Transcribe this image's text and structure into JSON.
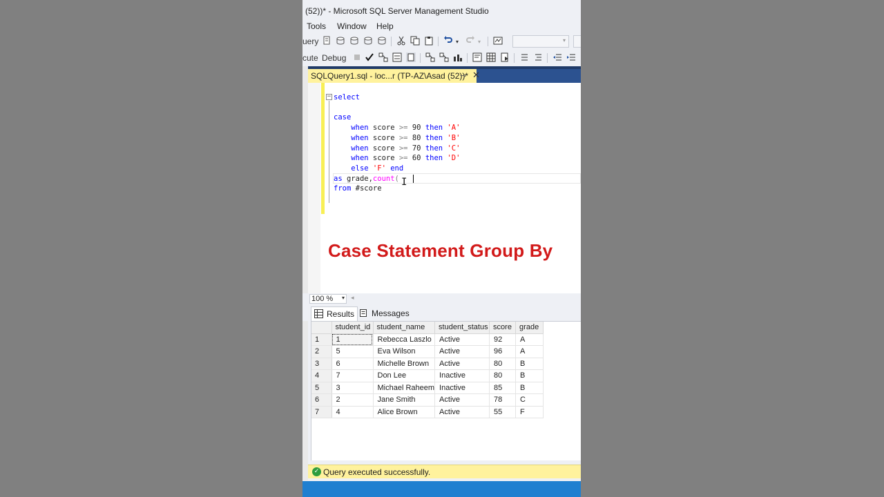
{
  "window": {
    "title": "(52))* - Microsoft SQL Server Management Studio"
  },
  "menu": [
    "Tools",
    "Window",
    "Help"
  ],
  "toolbar1": {
    "query_label": "uery"
  },
  "toolbar2": {
    "execute_label": "cute",
    "debug_label": "Debug"
  },
  "tab": {
    "label": "SQLQuery1.sql - loc...r (TP-AZ\\Asad (52))*",
    "pin": "⊸",
    "close": "✕"
  },
  "editor": {
    "line1": "select",
    "line_case": "case",
    "when": "when",
    "then": "then",
    "else": "else",
    "end": "end",
    "as": "as",
    "from": "from",
    "score": "score",
    "grade": " grade,",
    "count": "count",
    "table": " #score",
    "op_ge": ">=",
    "conditions": [
      {
        "value": "90",
        "grade": "'A'"
      },
      {
        "value": "80",
        "grade": "'B'"
      },
      {
        "value": "70",
        "grade": "'C'"
      },
      {
        "value": "60",
        "grade": "'D'"
      }
    ],
    "else_grade": "'F'",
    "count_arg": "("
  },
  "overlay": {
    "title": "Case Statement Group By"
  },
  "zoom": {
    "value": "100 %"
  },
  "results_tabs": {
    "results": "Results",
    "messages": "Messages"
  },
  "grid": {
    "columns": [
      "student_id",
      "student_name",
      "student_status",
      "score",
      "grade"
    ],
    "rows": [
      {
        "n": "1",
        "student_id": "1",
        "student_name": "Rebecca Laszlo",
        "student_status": "Active",
        "score": "92",
        "grade": "A"
      },
      {
        "n": "2",
        "student_id": "5",
        "student_name": "Eva Wilson",
        "student_status": "Active",
        "score": "96",
        "grade": "A"
      },
      {
        "n": "3",
        "student_id": "6",
        "student_name": "Michelle Brown",
        "student_status": "Active",
        "score": "80",
        "grade": "B"
      },
      {
        "n": "4",
        "student_id": "7",
        "student_name": "Don Lee",
        "student_status": "Inactive",
        "score": "80",
        "grade": "B"
      },
      {
        "n": "5",
        "student_id": "3",
        "student_name": "Michael Raheem",
        "student_status": "Inactive",
        "score": "85",
        "grade": "B"
      },
      {
        "n": "6",
        "student_id": "2",
        "student_name": "Jane Smith",
        "student_status": "Active",
        "score": "78",
        "grade": "C"
      },
      {
        "n": "7",
        "student_id": "4",
        "student_name": "Alice Brown",
        "student_status": "Active",
        "score": "55",
        "grade": "F"
      }
    ]
  },
  "status": {
    "message": "Query executed successfully."
  },
  "colors": {
    "accent_yellow": "#fff29d",
    "tab_blue": "#2c5290",
    "status_blue": "#1f7fd0",
    "overlay_red": "#d21a1a"
  }
}
